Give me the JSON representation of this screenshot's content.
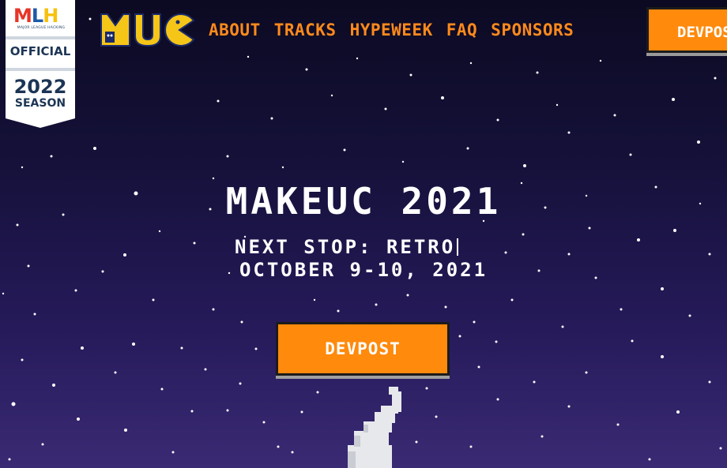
{
  "badge": {
    "logo_m": "M",
    "logo_l": "L",
    "logo_h": "H",
    "subtitle": "MAJOR LEAGUE HACKING",
    "official": "OFFICIAL",
    "year": "2022",
    "season": "SEASON"
  },
  "nav": {
    "items": [
      {
        "label": "ABOUT"
      },
      {
        "label": "TRACKS"
      },
      {
        "label": "HYPEWEEK"
      },
      {
        "label": "FAQ"
      },
      {
        "label": "SPONSORS"
      }
    ],
    "devpost_label": "DEVPOST"
  },
  "hero": {
    "title": "MAKEUC 2021",
    "tagline": "NEXT STOP: RETRO",
    "date": "OCTOBER 9-10, 2021",
    "button_label": "DEVPOST"
  },
  "colors": {
    "accent": "#ff8a0c",
    "nav_text": "#ff8a1c",
    "bg_top": "#0c0a22",
    "bg_bottom": "#3a2a74",
    "logo_yellow": "#f5c518",
    "logo_blue": "#1b2a6b"
  },
  "icons": {
    "logo": "muc-pacman-logo",
    "rocket": "rocket-smoke-trail"
  }
}
